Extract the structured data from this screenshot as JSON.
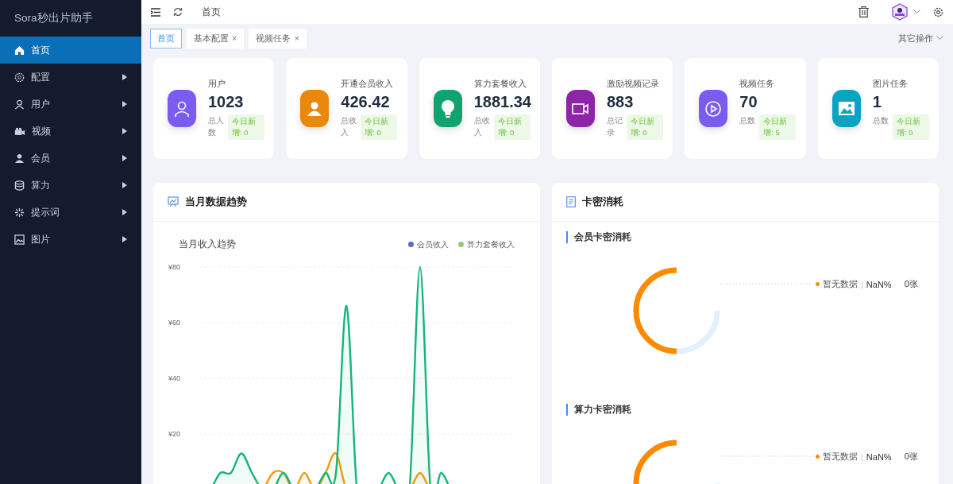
{
  "sidebar": {
    "title": "Sora秒出片助手",
    "items": [
      {
        "label": "首页",
        "selected": true,
        "has_children": false
      },
      {
        "label": "配置",
        "selected": false,
        "has_children": true
      },
      {
        "label": "用户",
        "selected": false,
        "has_children": true
      },
      {
        "label": "视频",
        "selected": false,
        "has_children": true
      },
      {
        "label": "会员",
        "selected": false,
        "has_children": true
      },
      {
        "label": "算力",
        "selected": false,
        "has_children": true
      },
      {
        "label": "提示词",
        "selected": false,
        "has_children": true
      },
      {
        "label": "图片",
        "selected": false,
        "has_children": true
      }
    ]
  },
  "header": {
    "breadcrumb": "首页"
  },
  "tabs": [
    {
      "label": "首页",
      "selected": true,
      "closable": false
    },
    {
      "label": "基本配置",
      "selected": false,
      "closable": true
    },
    {
      "label": "视频任务",
      "selected": false,
      "closable": true
    }
  ],
  "tabs_close": "×",
  "other_actions": "其它操作",
  "stats": [
    {
      "title": "用户",
      "value": "1023",
      "sub": "总人数",
      "today": "今日新增: 0",
      "color": "#7b5cf0"
    },
    {
      "title": "开通会员收入",
      "value": "426.42",
      "sub": "总收入",
      "today": "今日新增: 0",
      "color": "#e8890c"
    },
    {
      "title": "算力套餐收入",
      "value": "1881.34",
      "sub": "总收入",
      "today": "今日新增: 0",
      "color": "#11a36e"
    },
    {
      "title": "激励视频记录",
      "value": "883",
      "sub": "总记录",
      "today": "今日新增: 0",
      "color": "#8e24aa"
    },
    {
      "title": "视频任务",
      "value": "70",
      "sub": "总数",
      "today": "今日新增: 5",
      "color": "#7b5cf0"
    },
    {
      "title": "图片任务",
      "value": "1",
      "sub": "总数",
      "today": "今日新增: 0",
      "color": "#0aa3c2"
    }
  ],
  "trend_panel": {
    "title": "当月数据趋势",
    "chart_data": {
      "type": "area",
      "title": "当月收入趋势",
      "grid": true,
      "ylim": [
        0,
        80
      ],
      "yticks": [
        {
          "value": 20,
          "label": "¥20"
        },
        {
          "value": 40,
          "label": "¥40"
        },
        {
          "value": 60,
          "label": "¥60"
        },
        {
          "value": 80,
          "label": "¥80"
        }
      ],
      "series": [
        {
          "name": "会员收入",
          "color": "#f59a0b",
          "values": [
            0,
            0,
            0,
            0,
            0,
            0,
            0,
            6,
            6,
            0,
            6,
            0,
            6,
            13,
            0,
            0,
            0,
            0,
            0,
            0,
            0,
            6,
            0,
            0,
            0,
            0,
            0,
            0,
            0,
            0,
            0
          ]
        },
        {
          "name": "算力套餐收入",
          "color": "#15b57a",
          "values": [
            0,
            0,
            6,
            6,
            13,
            6,
            0,
            0,
            6,
            0,
            0,
            0,
            6,
            6,
            66,
            0,
            0,
            0,
            6,
            0,
            0,
            80,
            0,
            6,
            0,
            0,
            0,
            0,
            0,
            0,
            0
          ]
        }
      ]
    }
  },
  "card_panel": {
    "title": "卡密消耗",
    "sections": [
      {
        "title": "会员卡密消耗",
        "legend": "暂无数据",
        "separator": "|",
        "percent": "NaN%",
        "count": "0张"
      },
      {
        "title": "算力卡密消耗",
        "legend": "暂无数据",
        "separator": "|",
        "percent": "NaN%",
        "count": "0张"
      }
    ]
  }
}
